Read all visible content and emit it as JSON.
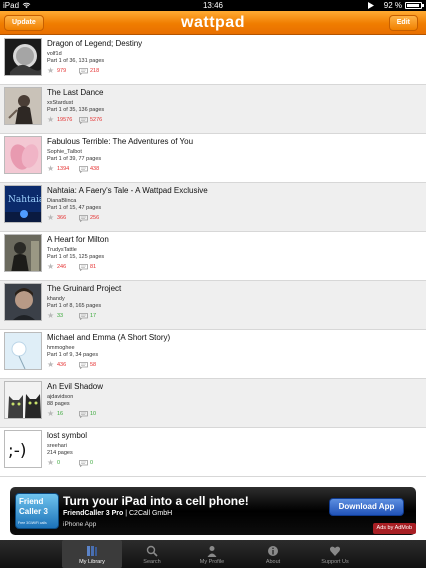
{
  "statusbar": {
    "device": "iPad",
    "time": "13:46",
    "battery": "92 %",
    "battery_level": 0.92
  },
  "header": {
    "logo": "wattpad",
    "update_label": "Update",
    "edit_label": "Edit",
    "accent": "#f08000"
  },
  "stories": [
    {
      "title": "Dragon of Legend; Destiny",
      "author": "volf1d",
      "parts": "Part 1 of 36, 131 pages",
      "votes": "979",
      "comments": "218",
      "stat_color": "red"
    },
    {
      "title": "The Last Dance",
      "author": "xxStardust",
      "parts": "Part 1 of 35, 136 pages",
      "votes": "19576",
      "comments": "5276",
      "stat_color": "red"
    },
    {
      "title": "Fabulous Terrible: The Adventures of You",
      "author": "Sophie_Talbot",
      "parts": "Part 1 of 39, 77 pages",
      "votes": "1394",
      "comments": "438",
      "stat_color": "red"
    },
    {
      "title": "Nahtaia: A Faery's Tale - A Wattpad Exclusive",
      "author": "DianaBlinca",
      "parts": "Part 1 of 15, 47 pages",
      "votes": "366",
      "comments": "256",
      "stat_color": "red"
    },
    {
      "title": "A Heart for Milton",
      "author": "TrudysTattle",
      "parts": "Part 1 of 15, 125 pages",
      "votes": "246",
      "comments": "81",
      "stat_color": "red"
    },
    {
      "title": "The Gruinard Project",
      "author": "khandy",
      "parts": "Part 1 of 8, 165 pages",
      "votes": "33",
      "comments": "17",
      "stat_color": "green"
    },
    {
      "title": "Michael and Emma  (A Short Story)",
      "author": "hmmoghee",
      "parts": "Part 1 of 9, 34 pages",
      "votes": "436",
      "comments": "58",
      "stat_color": "red"
    },
    {
      "title": "An Evil Shadow",
      "author": "ajdavidson",
      "parts": "88 pages",
      "votes": "16",
      "comments": "10",
      "stat_color": "green"
    },
    {
      "title": "lost symbol",
      "author": "sreehari",
      "parts": "214 pages",
      "votes": "0",
      "comments": "0",
      "stat_color": "green"
    }
  ],
  "ad": {
    "logo_line1": "Friend",
    "logo_line2": "Caller 3",
    "logo_tagline": "Free 3G/WiFi calls",
    "headline": "Turn your iPad into a cell phone!",
    "product": "FriendCaller 3 Pro",
    "vendor": " | C2Call GmbH",
    "type": "iPhone App",
    "button_label": "Download App",
    "network": "Ads by AdMob"
  },
  "tabs": [
    {
      "label": "My Library",
      "icon": "library-icon",
      "active": true
    },
    {
      "label": "Search",
      "icon": "search-icon",
      "active": false
    },
    {
      "label": "My Profile",
      "icon": "profile-icon",
      "active": false
    },
    {
      "label": "About",
      "icon": "about-icon",
      "active": false
    },
    {
      "label": "Support Us",
      "icon": "support-icon",
      "active": false
    }
  ]
}
